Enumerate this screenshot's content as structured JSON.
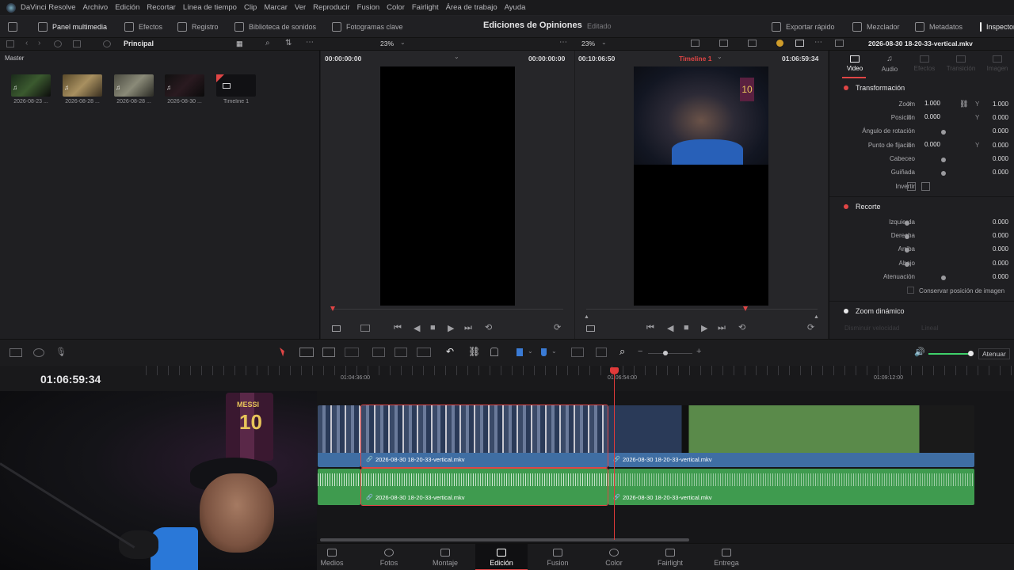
{
  "app": {
    "menu": [
      "DaVinci Resolve",
      "Archivo",
      "Edición",
      "Recortar",
      "Línea de tiempo",
      "Clip",
      "Marcar",
      "Ver",
      "Reproducir",
      "Fusion",
      "Color",
      "Fairlight",
      "Área de trabajo",
      "Ayuda"
    ]
  },
  "toolbar": {
    "media_pool": "Panel multimedia",
    "effects": "Efectos",
    "index": "Registro",
    "sound_library": "Biblioteca de sonidos",
    "keyframes": "Fotogramas clave",
    "project_title": "Ediciones de Opiniones",
    "project_status": "Editado",
    "quick_export": "Exportar rápido",
    "mixer": "Mezclador",
    "metadata": "Metadatos",
    "inspector": "Inspector"
  },
  "media_pool": {
    "bin_name": "Principal",
    "master_label": "Master",
    "clips": [
      {
        "label": "2026-08-23 ..."
      },
      {
        "label": "2026-08-28 ..."
      },
      {
        "label": "2026-08-28 ..."
      },
      {
        "label": "2026-08-30 ..."
      },
      {
        "label": "Timeline 1"
      }
    ]
  },
  "source_viewer": {
    "zoom": "23%",
    "timecode_left": "00:00:00:00",
    "timecode_right": "00:00:00:00"
  },
  "timeline_viewer": {
    "zoom": "23%",
    "duration": "00:10:06:50",
    "timeline_name": "Timeline 1",
    "timecode": "01:06:59:34"
  },
  "inspector": {
    "clip_name": "2026-08-30 18-20-33-vertical.mkv",
    "tabs": [
      "Video",
      "Audio",
      "Efectos",
      "Transición",
      "Imagen"
    ],
    "active_tab": "Video",
    "transform_title": "Transformación",
    "zoom_label": "Zoom",
    "zoom_x": "1.000",
    "zoom_y": "1.000",
    "position_label": "Posición",
    "position_x": "0.000",
    "position_y": "0.000",
    "rotation_label": "Ángulo de rotación",
    "rotation": "0.000",
    "anchor_label": "Punto de fijación",
    "anchor_x": "0.000",
    "anchor_y": "0.000",
    "pitch_label": "Cabeceo",
    "pitch": "0.000",
    "yaw_label": "Guiñada",
    "yaw": "0.000",
    "flip_label": "Invertir",
    "crop_title": "Recorte",
    "crop_left_label": "Izquierda",
    "crop_left": "0.000",
    "crop_right_label": "Derecha",
    "crop_right": "0.000",
    "crop_top_label": "Arriba",
    "crop_top": "0.000",
    "crop_bottom_label": "Abajo",
    "crop_bottom": "0.000",
    "softness_label": "Atenuación",
    "softness": "0.000",
    "retain_label": "Conservar posición de imagen",
    "dynamic_zoom_title": "Zoom dinámico",
    "dynamic_zoom_ease": "Disminuir velocidad",
    "dynamic_zoom_mode": "Lineal",
    "axis_x": "X",
    "axis_y": "Y",
    "accent": "#e04545"
  },
  "timeline": {
    "current_timecode": "01:06:59:34",
    "ruler": [
      "01:04:36:00",
      "01:06:54:00",
      "01:09:12:00"
    ],
    "fit_label": "Atenuar",
    "clips": [
      {
        "name": "2026-08-30 18-20-33-vertical.mkv"
      },
      {
        "name": "2026-08-30 18-20-33-vertical.mkv"
      }
    ],
    "audio_clips": [
      {
        "name": "2026-08-30 18-20-33-vertical.mkv"
      },
      {
        "name": "2026-08-30 18-20-33-vertical.mkv"
      }
    ],
    "video_color": "#3f6ea3",
    "audio_color": "#3f9b4f",
    "playhead_color": "#e03a3a"
  },
  "pages": [
    "Medios",
    "Fotos",
    "Montaje",
    "Edición",
    "Fusion",
    "Color",
    "Fairlight",
    "Entrega"
  ],
  "active_page": "Edición"
}
